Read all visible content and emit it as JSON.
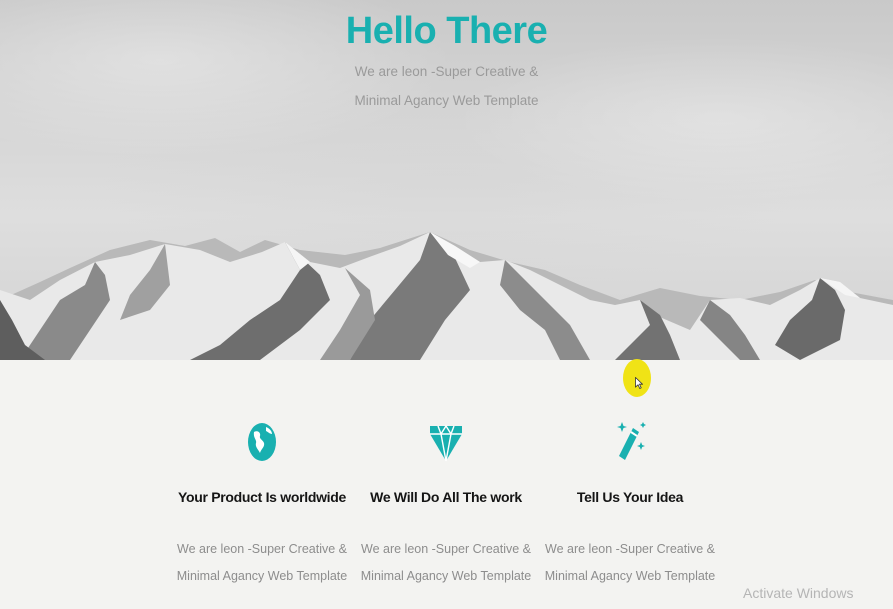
{
  "hero": {
    "title": "Hello There",
    "subtitle_line1": "We are leon -Super Creative &",
    "subtitle_line2": "Minimal Agancy Web Template"
  },
  "features": [
    {
      "icon": "globe-icon",
      "title": "Your Product Is worldwide",
      "text_line1": "We are leon -Super Creative &",
      "text_line2": "Minimal Agancy Web Template"
    },
    {
      "icon": "diamond-icon",
      "title": "We Will Do All The work",
      "text_line1": "We are leon -Super Creative &",
      "text_line2": "Minimal Agancy Web Template"
    },
    {
      "icon": "magic-wand-icon",
      "title": "Tell Us Your Idea",
      "text_line1": "We are leon -Super Creative &",
      "text_line2": "Minimal Agancy Web Template"
    }
  ],
  "watermark": "Activate Windows",
  "colors": {
    "accent": "#19b0b0",
    "heading": "#151515",
    "body_text": "#8d8d8d",
    "background": "#f3f3f1",
    "cursor_highlight": "#f0e316"
  }
}
